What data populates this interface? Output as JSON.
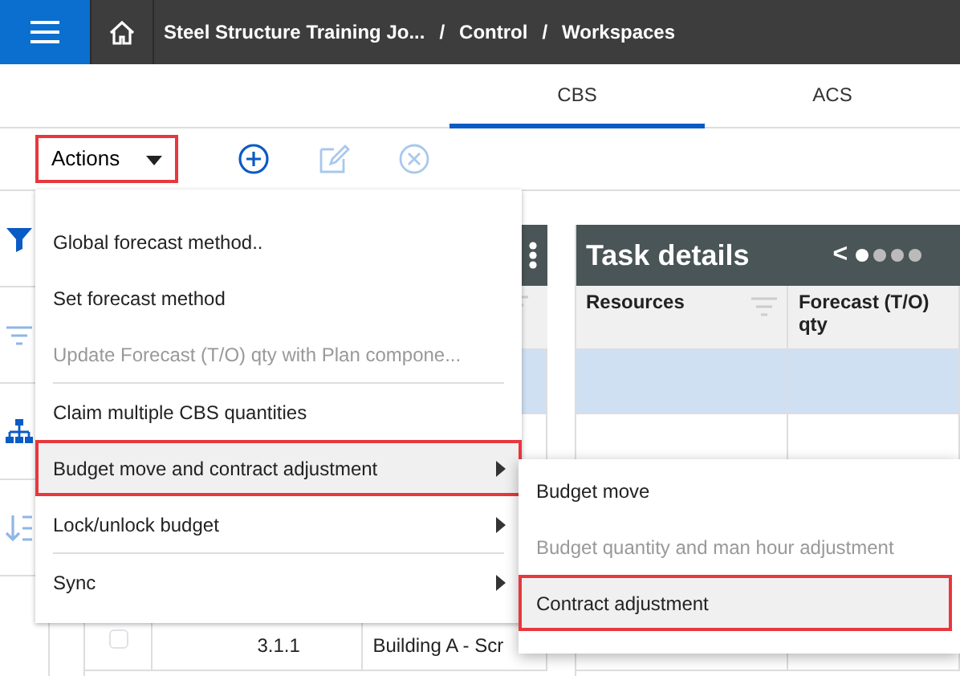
{
  "topbar": {
    "breadcrumb": [
      "Steel Structure Training Jo...",
      "Control",
      "Workspaces"
    ],
    "separator": "/"
  },
  "tabs": [
    {
      "label": "CBS",
      "selected": true
    },
    {
      "label": "ACS",
      "selected": false
    }
  ],
  "toolbar": {
    "actions": {
      "label": "Actions",
      "annotated": true
    },
    "tools": [
      {
        "kind": "add",
        "disabled": false
      },
      {
        "kind": "edit",
        "disabled": true
      },
      {
        "kind": "remove",
        "disabled": true
      }
    ]
  },
  "cbs_panel": {
    "rows": [
      {
        "selected": true,
        "cells": []
      },
      {
        "selected": false,
        "cells": []
      }
    ],
    "bottom_row": {
      "checked": false,
      "cells": [
        "3.1.1",
        "Building A - Scr"
      ]
    }
  },
  "task_panel": {
    "title": "Task details",
    "back": "<",
    "pages": [
      {
        "selected": true
      },
      {
        "selected": false
      },
      {
        "selected": false
      },
      {
        "selected": false
      }
    ],
    "columns": [
      "Resources",
      "Forecast (T/O) qty"
    ],
    "rows": [
      {
        "selected": true
      },
      {
        "selected": false
      }
    ]
  },
  "menu": [
    {
      "kind": "item",
      "label": "Global forecast method..",
      "disabled": false,
      "submenu": false,
      "selected": false,
      "annotated": false
    },
    {
      "kind": "item",
      "label": "Set forecast method",
      "disabled": false,
      "submenu": false,
      "selected": false,
      "annotated": false
    },
    {
      "kind": "item",
      "label": "Update Forecast (T/O) qty with Plan compone...",
      "disabled": true,
      "submenu": false,
      "selected": false,
      "annotated": false
    },
    {
      "kind": "divider"
    },
    {
      "kind": "item",
      "label": "Claim multiple CBS quantities",
      "disabled": false,
      "submenu": false,
      "selected": false,
      "annotated": false
    },
    {
      "kind": "item",
      "label": "Budget move and contract adjustment",
      "disabled": false,
      "submenu": true,
      "selected": true,
      "annotated": true
    },
    {
      "kind": "item",
      "label": "Lock/unlock budget",
      "disabled": false,
      "submenu": true,
      "selected": false,
      "annotated": false
    },
    {
      "kind": "divider"
    },
    {
      "kind": "item",
      "label": "Sync",
      "disabled": false,
      "submenu": true,
      "selected": false,
      "annotated": false
    }
  ],
  "submenu": [
    {
      "label": "Budget move",
      "disabled": false,
      "selected": false,
      "annotated": false
    },
    {
      "label": "Budget quantity and man hour adjustment",
      "disabled": true,
      "selected": false,
      "annotated": false
    },
    {
      "label": "Contract adjustment",
      "disabled": false,
      "selected": true,
      "annotated": true
    }
  ]
}
